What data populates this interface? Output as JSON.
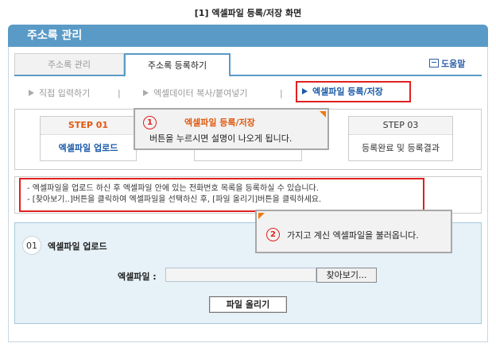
{
  "caption": "[1] 엑셀파일 등록/저장 화면",
  "header": {
    "title": "주소록 관리"
  },
  "tabs": [
    {
      "label": "주소록 관리"
    },
    {
      "label": "주소록 등록하기"
    }
  ],
  "help": {
    "label": "도움말"
  },
  "subnav": {
    "items": [
      {
        "label": "직접 입력하기"
      },
      {
        "label": "엑셀데이터 복사/붙여넣기"
      },
      {
        "label": "엑셀파일 등록/저장"
      }
    ],
    "separator": "|"
  },
  "steps": [
    {
      "title": "STEP 01",
      "desc": "엑셀파일 업로드"
    },
    {
      "title": "",
      "desc": ""
    },
    {
      "title": "STEP 03",
      "desc": "등록완료 및 등록결과"
    }
  ],
  "tooltip1": {
    "number": "1",
    "title": "엑셀파일 등록/저장",
    "text": "버튼을 누르시면 설명이 나오게 됩니다."
  },
  "tooltip2": {
    "number": "2",
    "text": "가지고 계신 엑셀파일을 불러옵니다."
  },
  "notes": [
    "- 엑셀파일을 업로드 하신 후 엑셀파일 안에 있는 전화번호 목록을 등록하실 수 있습니다.",
    "- [찾아보기..]버튼을 클릭하여 엑셀파일을 선택하신 후, [파일 올리기]버튼을 클릭하세요."
  ],
  "upload": {
    "number": "01",
    "title": "엑셀파일 업로드",
    "file_label": "엑셀파일 :",
    "file_value": "",
    "browse_label": "찾아보기...",
    "submit_label": "파일 올리기"
  },
  "colors": {
    "header": "#5a9ac6",
    "accent_red": "#e02020",
    "accent_orange": "#e05a10",
    "link_blue": "#1a5aa8"
  }
}
